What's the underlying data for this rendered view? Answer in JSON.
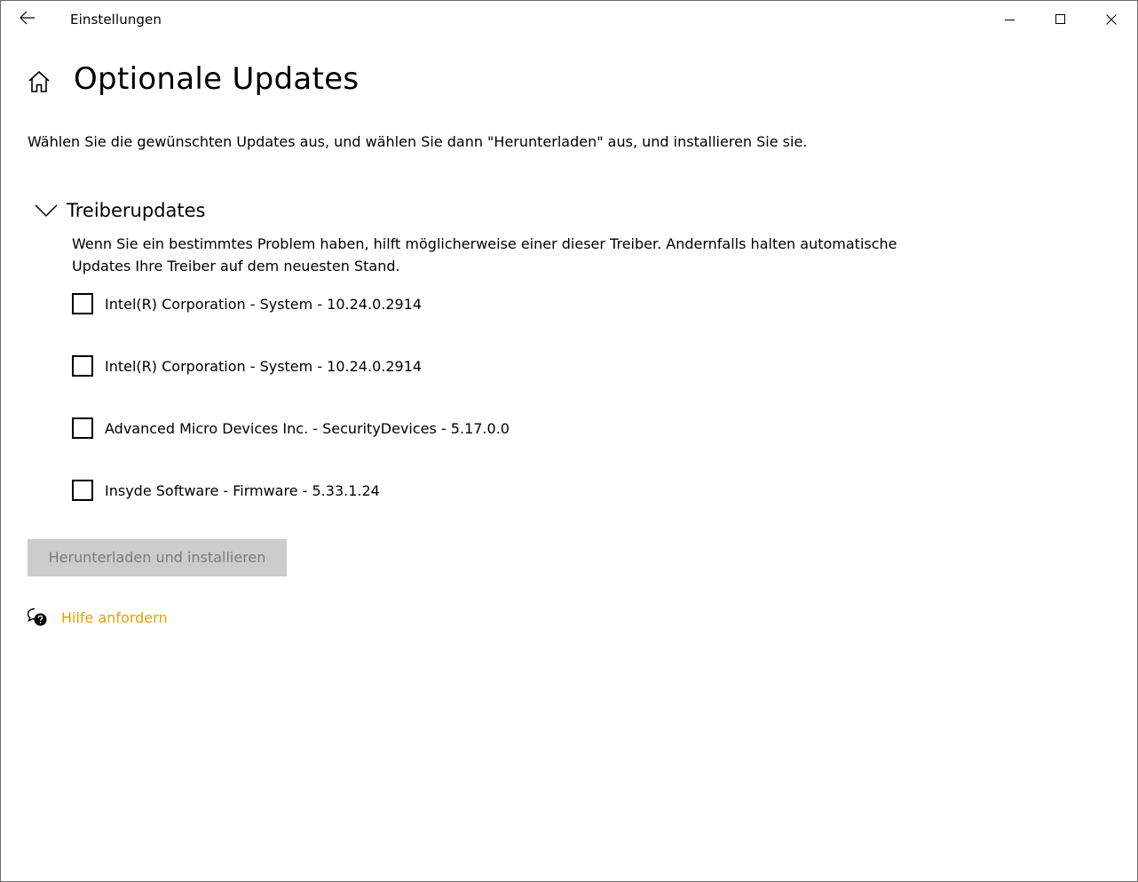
{
  "window": {
    "app_title": "Einstellungen",
    "back_icon": "arrow-left-icon",
    "minimize_icon": "minimize-icon",
    "maximize_icon": "maximize-icon",
    "close_icon": "close-icon"
  },
  "page": {
    "home_icon": "home-icon",
    "title": "Optionale Updates",
    "intro": "Wählen Sie die gewünschten Updates aus, und wählen Sie dann \"Herunterladen\" aus, und installieren Sie sie."
  },
  "section": {
    "expanded": true,
    "chevron_icon": "chevron-down-icon",
    "title": "Treiberupdates",
    "description": "Wenn Sie ein bestimmtes Problem haben, hilft möglicherweise einer dieser Treiber. Andernfalls halten automatische Updates Ihre Treiber auf dem neuesten Stand.",
    "drivers": [
      {
        "label": "Intel(R) Corporation - System - 10.24.0.2914",
        "checked": false
      },
      {
        "label": "Intel(R) Corporation - System - 10.24.0.2914",
        "checked": false
      },
      {
        "label": "Advanced Micro Devices Inc. - SecurityDevices - 5.17.0.0",
        "checked": false
      },
      {
        "label": "Insyde Software - Firmware - 5.33.1.24",
        "checked": false
      }
    ]
  },
  "actions": {
    "install_label": "Herunterladen und installieren",
    "install_enabled": false
  },
  "help": {
    "icon": "help-chat-icon",
    "label": "Hilfe anfordern",
    "link_color": "#e5a100"
  },
  "colors": {
    "disabled_button_bg": "#cccccc",
    "disabled_button_text": "#7a7a7a"
  }
}
